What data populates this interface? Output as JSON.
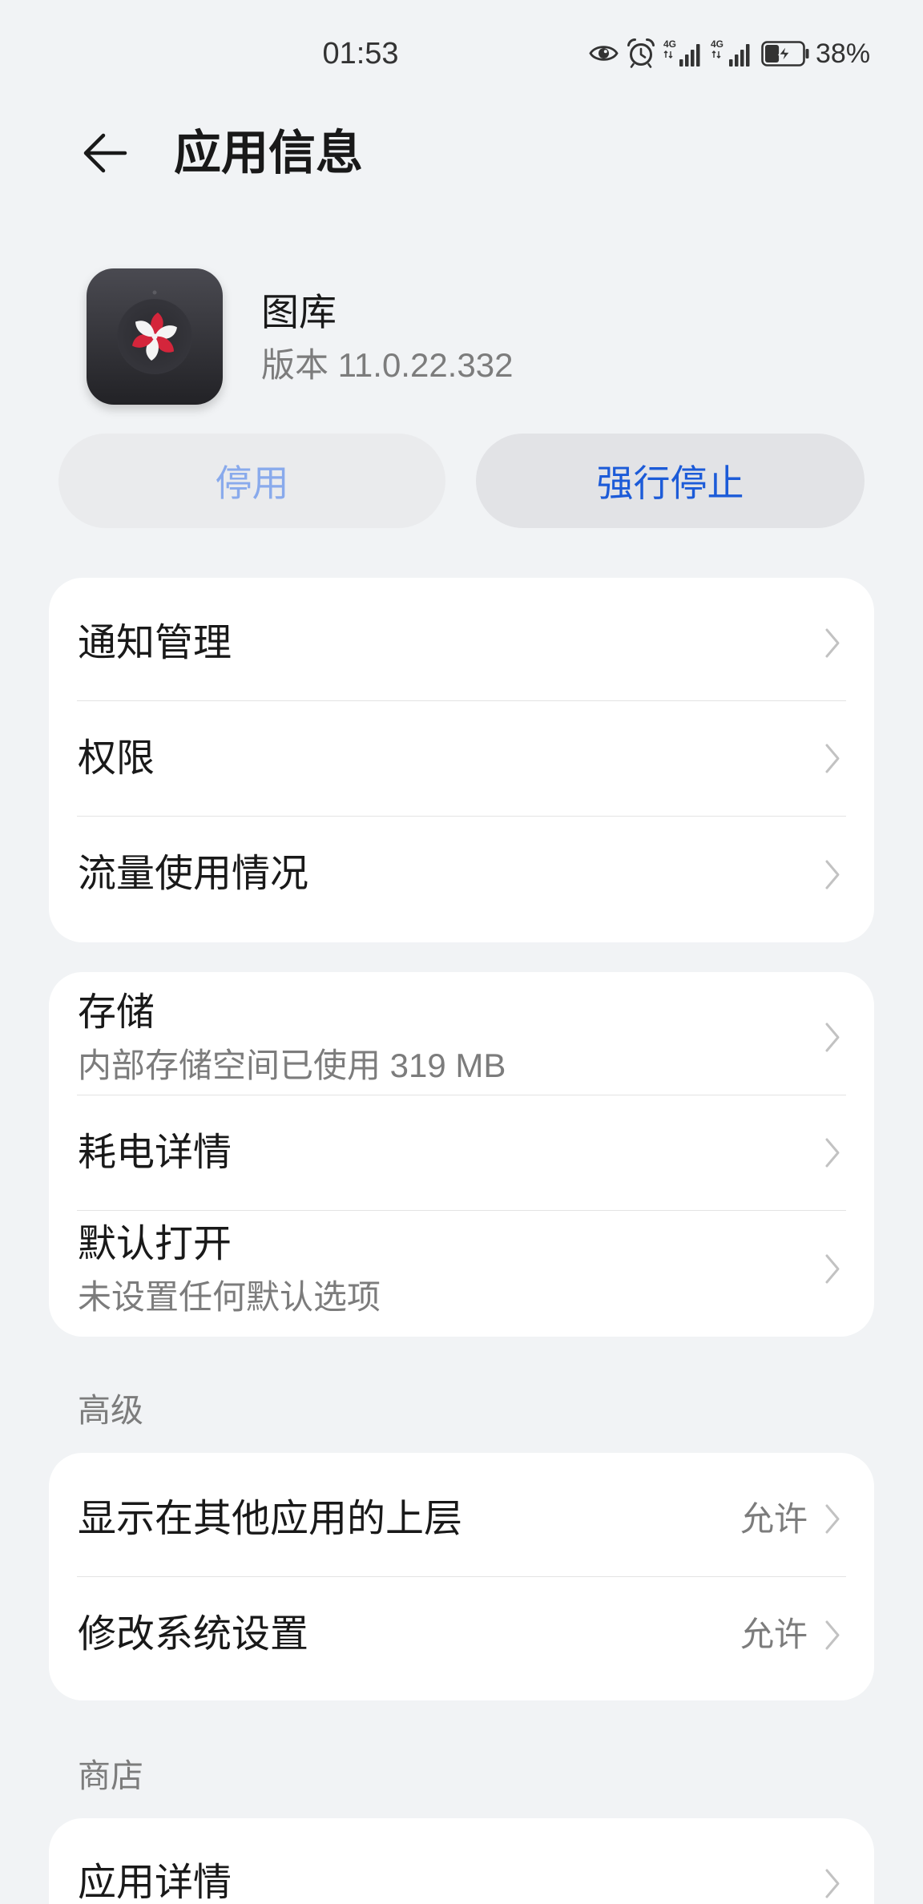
{
  "status_bar": {
    "time": "01:53",
    "network_1": "4G",
    "network_2": "4G",
    "battery_percent": "38%",
    "battery_level": 0.38,
    "icons": [
      "eye-comfort-icon",
      "alarm-icon",
      "signal-icon",
      "signal-icon",
      "battery-charging-icon"
    ]
  },
  "header": {
    "back_icon": "back-arrow-icon",
    "title": "应用信息"
  },
  "app": {
    "icon": "gallery-app-icon",
    "name": "图库",
    "version": "版本 11.0.22.332"
  },
  "actions": {
    "disable": {
      "label": "停用",
      "enabled": false
    },
    "force_stop": {
      "label": "强行停止",
      "enabled": true
    }
  },
  "settings": {
    "chevron_icon": "chevron-right-icon",
    "group_basic": [
      {
        "label": "通知管理"
      },
      {
        "label": "权限"
      },
      {
        "label": "流量使用情况"
      }
    ],
    "group_resources": [
      {
        "label": "存储",
        "subtitle": "内部存储空间已使用 319 MB"
      },
      {
        "label": "耗电详情"
      },
      {
        "label": "默认打开",
        "subtitle": "未设置任何默认选项"
      }
    ],
    "advanced": {
      "header": "高级",
      "items": [
        {
          "label": "显示在其他应用的上层",
          "value": "允许"
        },
        {
          "label": "修改系统设置",
          "value": "允许"
        }
      ]
    },
    "store": {
      "header": "商店",
      "items": [
        {
          "label": "应用详情"
        }
      ]
    }
  },
  "colors": {
    "background": "#f1f3f5",
    "card": "#ffffff",
    "text_primary": "#191919",
    "text_secondary": "#7c7c7c",
    "accent": "#1c5bd8",
    "accent_disabled": "#89aaec",
    "button_bg": "#e2e3e6",
    "button_bg_disabled": "#eaebed",
    "divider": "#e3e3e3",
    "chevron": "#c2c2c2",
    "status_text": "#333333"
  }
}
